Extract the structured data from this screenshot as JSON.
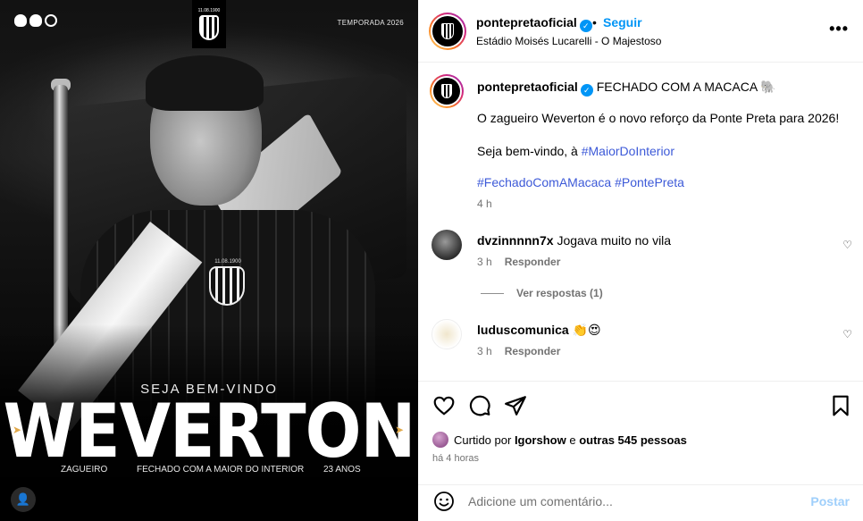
{
  "media": {
    "season_label": "TEMPORADA 2026",
    "badge_date": "11.08.1900",
    "welcome": "SEJA BEM-VINDO",
    "player_name": "WEVERTON",
    "position": "ZAGUEIRO",
    "tagline": "FECHADO COM A MAIOR DO INTERIOR",
    "age": "23 ANOS",
    "accent_color": "#e0a84a"
  },
  "header": {
    "username": "pontepretaoficial",
    "separator": "•",
    "follow_label": "Seguir",
    "location": "Estádio Moisés Lucarelli - O Majestoso",
    "more_icon": "more-horizontal-icon"
  },
  "caption": {
    "username": "pontepretaoficial",
    "title": "FECHADO COM A MACACA 🐘",
    "line1": "O zagueiro Weverton é o novo reforço da Ponte Preta para 2026!",
    "line2_prefix": "Seja bem-vindo, à ",
    "line2_tag": "#MaiorDoInterior",
    "tag1": "#FechadoComAMacaca",
    "tag2": "#PontePreta",
    "time": "4 h"
  },
  "comments": [
    {
      "username": "dvzinnnnn7x",
      "text": "Jogava muito no vila",
      "time": "3 h",
      "reply_label": "Responder",
      "view_replies": "Ver respostas (1)"
    },
    {
      "username": "luduscomunica",
      "text": "👏😍",
      "time": "3 h",
      "reply_label": "Responder"
    }
  ],
  "actions": {
    "liked_prefix": "Curtido por ",
    "liked_user": "Igorshow",
    "liked_middle": " e ",
    "liked_rest": "outras 545 pessoas",
    "time_ago": "há 4 horas"
  },
  "add_comment": {
    "placeholder": "Adicione um comentário...",
    "post_label": "Postar"
  },
  "colors": {
    "link_blue": "#0095f6",
    "hashtag": "#3d5ad8",
    "muted": "#737373"
  }
}
